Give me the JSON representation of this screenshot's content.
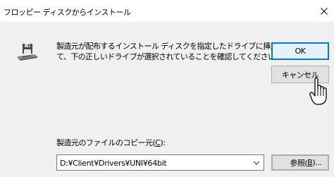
{
  "window": {
    "title": "フロッピー ディスクからインストール"
  },
  "dialog": {
    "message_line1": "製造元が配布するインストール ディスクを指定したドライブに挿入し",
    "message_line2": "て、下の正しいドライブが選択されていることを確認してください。",
    "ok_label": "OK",
    "cancel_label": "キャンセル",
    "copy_label_prefix": "製造元のファイルのコピー元(",
    "copy_label_key": "C",
    "copy_label_suffix": "):",
    "path_value": "D:¥Client¥Drivers¥UNI¥64bit",
    "browse_label_prefix": "参照(",
    "browse_label_key": "B",
    "browse_label_suffix": ")..."
  },
  "icons": {
    "floppy": "floppy-disk-drive-icon",
    "close": "close-icon",
    "dropdown": "chevron-down-icon",
    "cursor": "hand-pointer-cursor"
  },
  "colors": {
    "accent": "#0078d7",
    "dialog_bg": "#f0f0f0",
    "button_bg": "#e1e1e1"
  }
}
